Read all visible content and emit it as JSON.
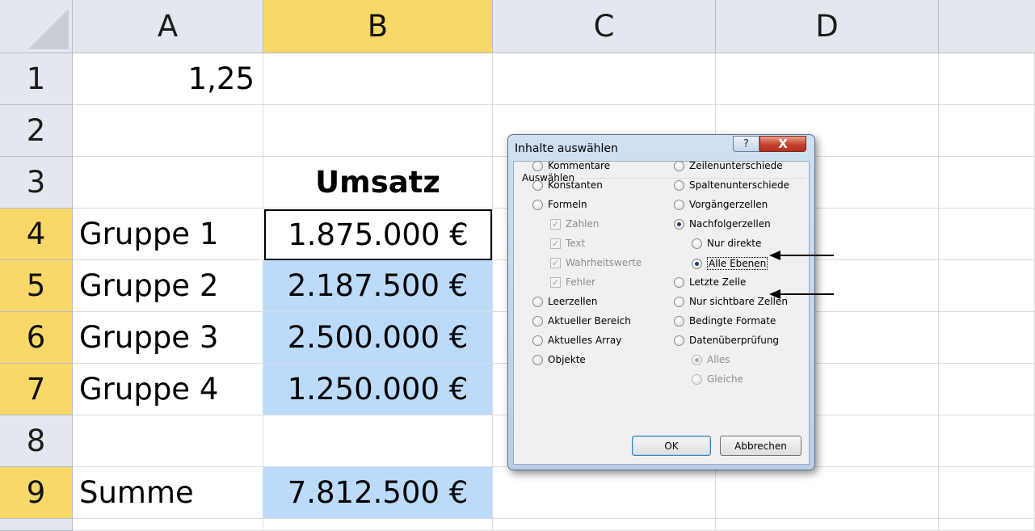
{
  "sheet": {
    "columns": [
      "A",
      "B",
      "C",
      "D"
    ],
    "rows": [
      "1",
      "2",
      "3",
      "4",
      "5",
      "6",
      "7",
      "8",
      "9"
    ],
    "selected_column": "B",
    "selected_rows": [
      "4",
      "5",
      "6",
      "7",
      "9"
    ],
    "cells": {
      "A1": "1,25",
      "B3": "Umsatz",
      "A4": "Gruppe 1",
      "B4": "1.875.000 €",
      "A5": "Gruppe 2",
      "B5": "2.187.500 €",
      "A6": "Gruppe 3",
      "B6": "2.500.000 €",
      "A7": "Gruppe 4",
      "B7": "1.250.000 €",
      "A9": "Summe",
      "B9": "7.812.500 €"
    },
    "colors": {
      "header_bg": "#e4e8ee",
      "header_selected": "#f9d86a",
      "cell_highlight": "#bcdbfb"
    }
  },
  "dialog": {
    "title": "Inhalte auswählen",
    "help_label": "?",
    "close_label": "X",
    "group_label": "Auswählen",
    "left_options": [
      {
        "label": "Kommentare",
        "type": "radio",
        "checked": false,
        "disabled": false
      },
      {
        "label": "Konstanten",
        "type": "radio",
        "checked": false,
        "disabled": false
      },
      {
        "label": "Formeln",
        "type": "radio",
        "checked": false,
        "disabled": false
      },
      {
        "label": "Zahlen",
        "type": "checkbox",
        "checked": true,
        "disabled": true
      },
      {
        "label": "Text",
        "type": "checkbox",
        "checked": true,
        "disabled": true
      },
      {
        "label": "Wahrheitswerte",
        "type": "checkbox",
        "checked": true,
        "disabled": true
      },
      {
        "label": "Fehler",
        "type": "checkbox",
        "checked": true,
        "disabled": true
      },
      {
        "label": "Leerzellen",
        "type": "radio",
        "checked": false,
        "disabled": false
      },
      {
        "label": "Aktueller Bereich",
        "type": "radio",
        "checked": false,
        "disabled": false
      },
      {
        "label": "Aktuelles Array",
        "type": "radio",
        "checked": false,
        "disabled": false
      },
      {
        "label": "Objekte",
        "type": "radio",
        "checked": false,
        "disabled": false
      }
    ],
    "right_options": [
      {
        "label": "Zeilenunterschiede",
        "type": "radio",
        "checked": false,
        "disabled": false
      },
      {
        "label": "Spaltenunterschiede",
        "type": "radio",
        "checked": false,
        "disabled": false
      },
      {
        "label": "Vorgängerzellen",
        "type": "radio",
        "checked": false,
        "disabled": false
      },
      {
        "label": "Nachfolgerzellen",
        "type": "radio",
        "checked": true,
        "disabled": false
      },
      {
        "label": "Nur direkte",
        "type": "radio",
        "checked": false,
        "disabled": false
      },
      {
        "label": "Alle Ebenen",
        "type": "radio",
        "checked": true,
        "disabled": false
      },
      {
        "label": "Letzte Zelle",
        "type": "radio",
        "checked": false,
        "disabled": false
      },
      {
        "label": "Nur sichtbare Zellen",
        "type": "radio",
        "checked": false,
        "disabled": false
      },
      {
        "label": "Bedingte Formate",
        "type": "radio",
        "checked": false,
        "disabled": false
      },
      {
        "label": "Datenüberprüfung",
        "type": "radio",
        "checked": false,
        "disabled": false
      },
      {
        "label": "Alles",
        "type": "radio",
        "checked": true,
        "disabled": true
      },
      {
        "label": "Gleiche",
        "type": "radio",
        "checked": false,
        "disabled": true
      }
    ],
    "ok_label": "OK",
    "cancel_label": "Abbrechen"
  }
}
